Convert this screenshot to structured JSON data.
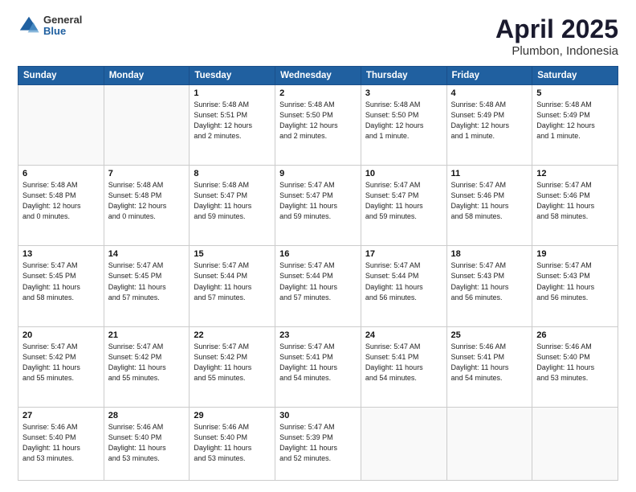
{
  "header": {
    "logo_general": "General",
    "logo_blue": "Blue",
    "title": "April 2025",
    "location": "Plumbon, Indonesia"
  },
  "weekdays": [
    "Sunday",
    "Monday",
    "Tuesday",
    "Wednesday",
    "Thursday",
    "Friday",
    "Saturday"
  ],
  "weeks": [
    [
      {
        "day": "",
        "info": ""
      },
      {
        "day": "",
        "info": ""
      },
      {
        "day": "1",
        "info": "Sunrise: 5:48 AM\nSunset: 5:51 PM\nDaylight: 12 hours\nand 2 minutes."
      },
      {
        "day": "2",
        "info": "Sunrise: 5:48 AM\nSunset: 5:50 PM\nDaylight: 12 hours\nand 2 minutes."
      },
      {
        "day": "3",
        "info": "Sunrise: 5:48 AM\nSunset: 5:50 PM\nDaylight: 12 hours\nand 1 minute."
      },
      {
        "day": "4",
        "info": "Sunrise: 5:48 AM\nSunset: 5:49 PM\nDaylight: 12 hours\nand 1 minute."
      },
      {
        "day": "5",
        "info": "Sunrise: 5:48 AM\nSunset: 5:49 PM\nDaylight: 12 hours\nand 1 minute."
      }
    ],
    [
      {
        "day": "6",
        "info": "Sunrise: 5:48 AM\nSunset: 5:48 PM\nDaylight: 12 hours\nand 0 minutes."
      },
      {
        "day": "7",
        "info": "Sunrise: 5:48 AM\nSunset: 5:48 PM\nDaylight: 12 hours\nand 0 minutes."
      },
      {
        "day": "8",
        "info": "Sunrise: 5:48 AM\nSunset: 5:47 PM\nDaylight: 11 hours\nand 59 minutes."
      },
      {
        "day": "9",
        "info": "Sunrise: 5:47 AM\nSunset: 5:47 PM\nDaylight: 11 hours\nand 59 minutes."
      },
      {
        "day": "10",
        "info": "Sunrise: 5:47 AM\nSunset: 5:47 PM\nDaylight: 11 hours\nand 59 minutes."
      },
      {
        "day": "11",
        "info": "Sunrise: 5:47 AM\nSunset: 5:46 PM\nDaylight: 11 hours\nand 58 minutes."
      },
      {
        "day": "12",
        "info": "Sunrise: 5:47 AM\nSunset: 5:46 PM\nDaylight: 11 hours\nand 58 minutes."
      }
    ],
    [
      {
        "day": "13",
        "info": "Sunrise: 5:47 AM\nSunset: 5:45 PM\nDaylight: 11 hours\nand 58 minutes."
      },
      {
        "day": "14",
        "info": "Sunrise: 5:47 AM\nSunset: 5:45 PM\nDaylight: 11 hours\nand 57 minutes."
      },
      {
        "day": "15",
        "info": "Sunrise: 5:47 AM\nSunset: 5:44 PM\nDaylight: 11 hours\nand 57 minutes."
      },
      {
        "day": "16",
        "info": "Sunrise: 5:47 AM\nSunset: 5:44 PM\nDaylight: 11 hours\nand 57 minutes."
      },
      {
        "day": "17",
        "info": "Sunrise: 5:47 AM\nSunset: 5:44 PM\nDaylight: 11 hours\nand 56 minutes."
      },
      {
        "day": "18",
        "info": "Sunrise: 5:47 AM\nSunset: 5:43 PM\nDaylight: 11 hours\nand 56 minutes."
      },
      {
        "day": "19",
        "info": "Sunrise: 5:47 AM\nSunset: 5:43 PM\nDaylight: 11 hours\nand 56 minutes."
      }
    ],
    [
      {
        "day": "20",
        "info": "Sunrise: 5:47 AM\nSunset: 5:42 PM\nDaylight: 11 hours\nand 55 minutes."
      },
      {
        "day": "21",
        "info": "Sunrise: 5:47 AM\nSunset: 5:42 PM\nDaylight: 11 hours\nand 55 minutes."
      },
      {
        "day": "22",
        "info": "Sunrise: 5:47 AM\nSunset: 5:42 PM\nDaylight: 11 hours\nand 55 minutes."
      },
      {
        "day": "23",
        "info": "Sunrise: 5:47 AM\nSunset: 5:41 PM\nDaylight: 11 hours\nand 54 minutes."
      },
      {
        "day": "24",
        "info": "Sunrise: 5:47 AM\nSunset: 5:41 PM\nDaylight: 11 hours\nand 54 minutes."
      },
      {
        "day": "25",
        "info": "Sunrise: 5:46 AM\nSunset: 5:41 PM\nDaylight: 11 hours\nand 54 minutes."
      },
      {
        "day": "26",
        "info": "Sunrise: 5:46 AM\nSunset: 5:40 PM\nDaylight: 11 hours\nand 53 minutes."
      }
    ],
    [
      {
        "day": "27",
        "info": "Sunrise: 5:46 AM\nSunset: 5:40 PM\nDaylight: 11 hours\nand 53 minutes."
      },
      {
        "day": "28",
        "info": "Sunrise: 5:46 AM\nSunset: 5:40 PM\nDaylight: 11 hours\nand 53 minutes."
      },
      {
        "day": "29",
        "info": "Sunrise: 5:46 AM\nSunset: 5:40 PM\nDaylight: 11 hours\nand 53 minutes."
      },
      {
        "day": "30",
        "info": "Sunrise: 5:47 AM\nSunset: 5:39 PM\nDaylight: 11 hours\nand 52 minutes."
      },
      {
        "day": "",
        "info": ""
      },
      {
        "day": "",
        "info": ""
      },
      {
        "day": "",
        "info": ""
      }
    ]
  ]
}
